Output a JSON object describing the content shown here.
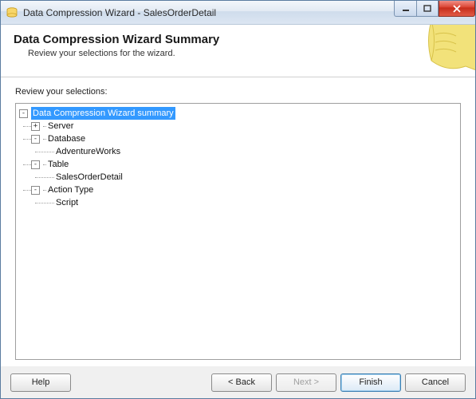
{
  "window": {
    "title": "Data Compression Wizard - SalesOrderDetail"
  },
  "header": {
    "title": "Data Compression Wizard Summary",
    "subtitle": "Review your selections for the wizard."
  },
  "body": {
    "review_label": "Review your selections:"
  },
  "tree": {
    "root": {
      "label": "Data Compression Wizard summary",
      "children": {
        "server": {
          "label": "Server"
        },
        "database": {
          "label": "Database",
          "child": "AdventureWorks"
        },
        "table": {
          "label": "Table",
          "child": "SalesOrderDetail"
        },
        "action_type": {
          "label": "Action Type",
          "child": "Script"
        }
      }
    }
  },
  "footer": {
    "help": "Help",
    "back": "< Back",
    "next": "Next >",
    "finish": "Finish",
    "cancel": "Cancel"
  }
}
